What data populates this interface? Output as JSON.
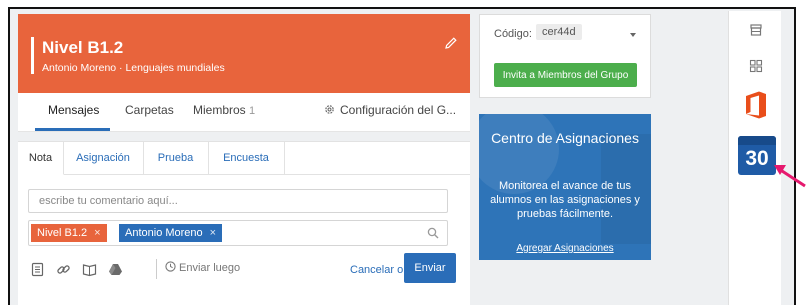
{
  "group": {
    "title": "Nivel B1.2",
    "subtitle": "Antonio Moreno · Lenguajes mundiales"
  },
  "tabs": {
    "messages": "Mensajes",
    "folders": "Carpetas",
    "members": "Miembros",
    "members_count": "1",
    "settings": "Configuración del G..."
  },
  "composer": {
    "tabs": [
      "Nota",
      "Asignación",
      "Prueba",
      "Encuesta"
    ],
    "placeholder": "escribe tu comentario aquí...",
    "recipients": [
      "Nivel B1.2",
      "Antonio Moreno"
    ],
    "remove_glyph": "×",
    "send_later": "Enviar luego",
    "cancel": "Cancelar o",
    "send": "Enviar"
  },
  "code_card": {
    "label": "Código:",
    "code": "cer44d",
    "invite": "Invita a Miembros del Grupo"
  },
  "promo": {
    "title": "Centro de Asignaciones",
    "body": "Monitorea el avance de tus alumnos en las asignaciones y pruebas fácilmente.",
    "link": "Agregar Asignaciones"
  },
  "sidebar": {
    "calendar_day": "30",
    "icons": [
      "store-icon",
      "apps-grid-icon",
      "office-icon",
      "calendar-icon"
    ]
  },
  "colors": {
    "header": "#e8643c",
    "primary": "#2a6db8",
    "invite_green": "#4cae4c",
    "promo_blue": "#2e74b8",
    "annotation_arrow": "#e6196e"
  }
}
